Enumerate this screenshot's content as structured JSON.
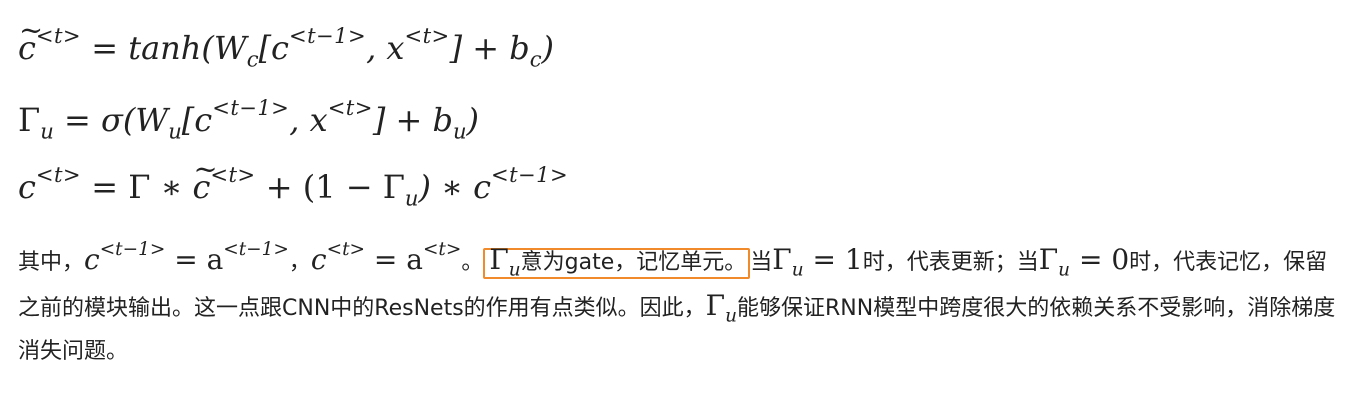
{
  "equations": {
    "eq1": {
      "lhs": "c",
      "lhs_sup": "<t>",
      "rhs_parts": [
        "tanh(W",
        "c",
        "[c",
        "<t−1>",
        ", x",
        "<t>",
        "] + b",
        "c",
        ")"
      ]
    },
    "eq2": {
      "lhs": "Γ",
      "lhs_sub": "u",
      "rhs_parts": [
        "σ(W",
        "u",
        "[c",
        "<t−1>",
        ", x",
        "<t>",
        "] + b",
        "u",
        ")"
      ]
    },
    "eq3": {
      "lhs": "c",
      "lhs_sup": "<t>",
      "rhs_parts": [
        "Γ ∗ ",
        "c",
        "<t>",
        " + (1 − Γ",
        "u",
        ") ∗ c",
        "<t−1>"
      ]
    }
  },
  "paragraph": {
    "p1": "其中，",
    "m1_base": "c",
    "m1_sup": "<t−1>",
    "m1_eq": " = a",
    "m1_sup2": "<t−1>",
    "p2": "，",
    "m2_base": "c",
    "m2_sup": "<t>",
    "m2_eq": " = a",
    "m2_sup2": "<t>",
    "p3": "。",
    "hl_gamma": "Γ",
    "hl_sub": "u",
    "hl_text": "意为gate，记忆单元。",
    "p4": "当",
    "m3_gamma": "Γ",
    "m3_sub": "u",
    "m3_rest": " = 1",
    "p5": "时，代表更新；当",
    "m4_gamma": "Γ",
    "m4_sub": "u",
    "m4_rest": " = 0",
    "p6": "时，代表记忆，保留之前的模块输出。这一点跟CNN中的ResNets的作用有点类似。因此，",
    "m5_gamma": "Γ",
    "m5_sub": "u",
    "p7": "能够保证RNN模型中跨度很大的依赖关系不受影响，消除梯度消失问题。"
  },
  "colors": {
    "highlight_border": "#f08a2a",
    "text": "#222222"
  }
}
